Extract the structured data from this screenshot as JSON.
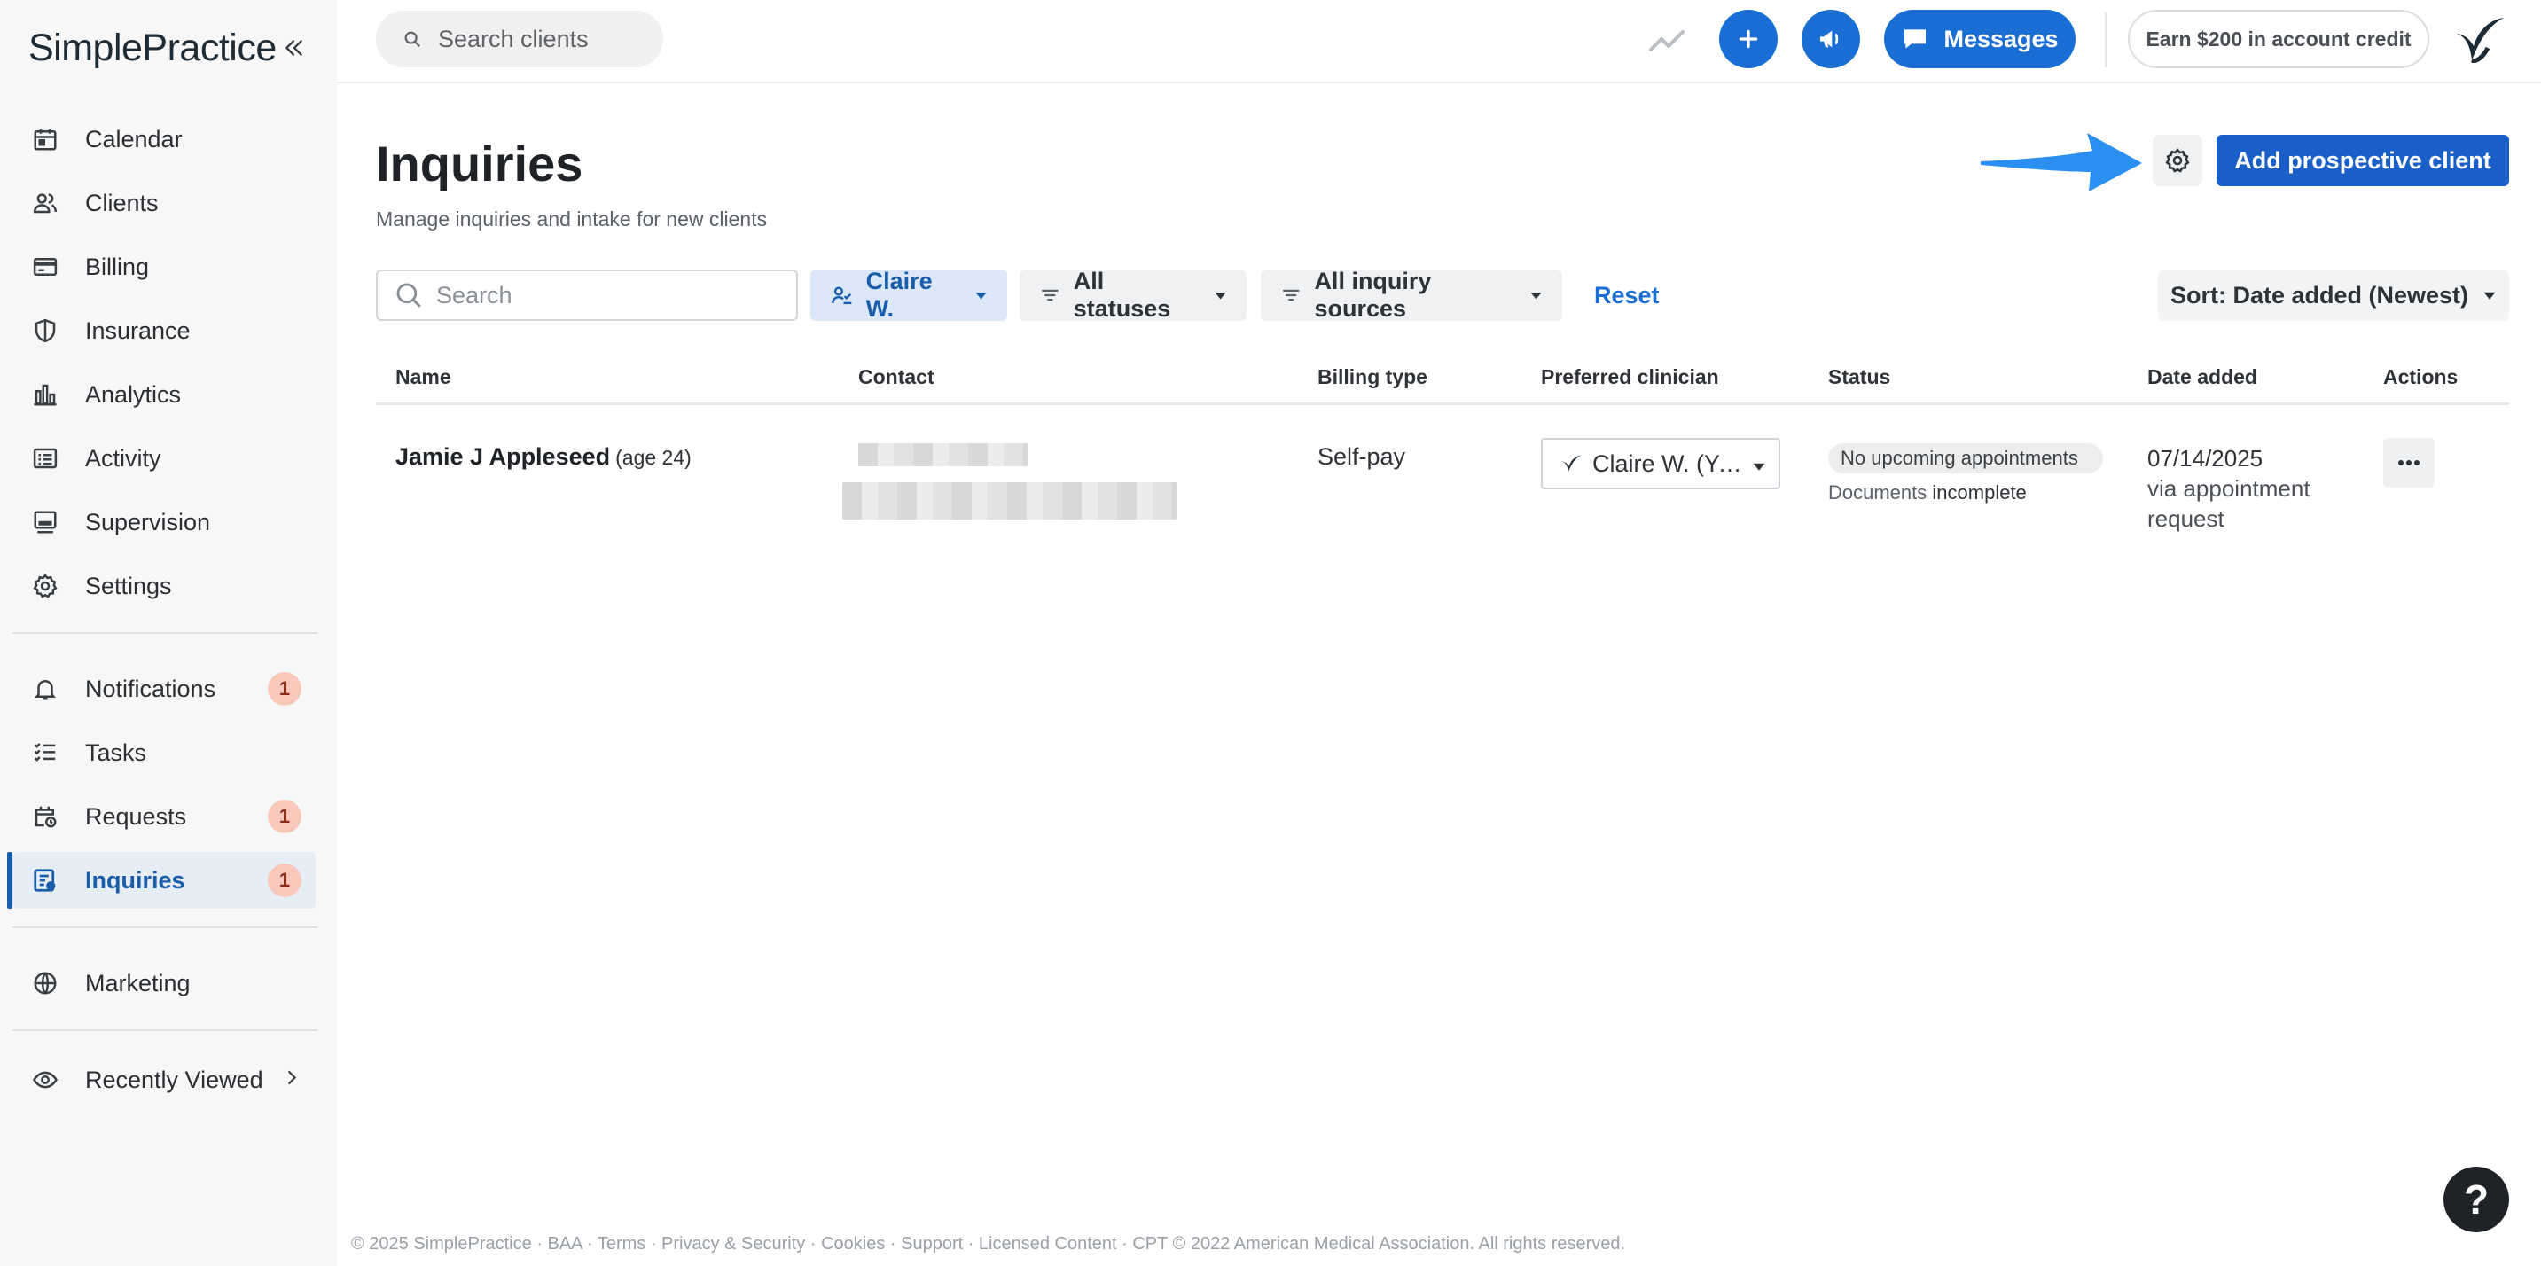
{
  "brand": {
    "logo_text": "SimplePractice"
  },
  "sidebar": {
    "items": [
      {
        "label": "Calendar",
        "icon": "calendar-icon"
      },
      {
        "label": "Clients",
        "icon": "clients-icon"
      },
      {
        "label": "Billing",
        "icon": "credit-card-icon"
      },
      {
        "label": "Insurance",
        "icon": "shield-icon"
      },
      {
        "label": "Analytics",
        "icon": "bar-chart-icon"
      },
      {
        "label": "Activity",
        "icon": "list-icon"
      },
      {
        "label": "Supervision",
        "icon": "supervision-icon"
      },
      {
        "label": "Settings",
        "icon": "gear-icon"
      },
      {
        "label": "Notifications",
        "icon": "bell-icon",
        "badge": "1"
      },
      {
        "label": "Tasks",
        "icon": "tasks-icon"
      },
      {
        "label": "Requests",
        "icon": "calendar-clock-icon",
        "badge": "1"
      },
      {
        "label": "Inquiries",
        "icon": "inquiries-icon",
        "badge": "1",
        "active": true
      },
      {
        "label": "Marketing",
        "icon": "globe-icon"
      },
      {
        "label": "Recently Viewed",
        "icon": "eye-icon"
      }
    ]
  },
  "topbar": {
    "search_placeholder": "Search clients",
    "messages_label": "Messages",
    "credit_label": "Earn $200 in account credit"
  },
  "page": {
    "title": "Inquiries",
    "subtitle": "Manage inquiries and intake for new clients",
    "add_button": "Add prospective client"
  },
  "filters": {
    "search_placeholder": "Search",
    "clinician": "Claire W.",
    "statuses": "All statuses",
    "sources": "All inquiry sources",
    "reset": "Reset",
    "sort": "Sort: Date added (Newest)"
  },
  "table": {
    "headers": [
      "Name",
      "Contact",
      "Billing type",
      "Preferred clinician",
      "Status",
      "Date added",
      "Actions"
    ],
    "rows": [
      {
        "name": "Jamie J Appleseed",
        "age": "(age 24)",
        "billing_type": "Self-pay",
        "clinician": "Claire W. (You)",
        "status": "No upcoming appointments",
        "documents_label": "Documents",
        "documents_state": "incomplete",
        "date": "07/14/2025",
        "date_source_1": "via appointment",
        "date_source_2": "request"
      }
    ]
  },
  "footer": {
    "text": "© 2025 SimplePractice · BAA · Terms · Privacy & Security · Cookies · Support · Licensed Content · CPT © 2022 American Medical Association. All rights reserved."
  },
  "help": {
    "label": "?"
  },
  "colors": {
    "primary": "#1a5fc8",
    "accent": "#1a6ed3",
    "active_nav": "#1a5da8",
    "badge": "#f9c8bd"
  }
}
